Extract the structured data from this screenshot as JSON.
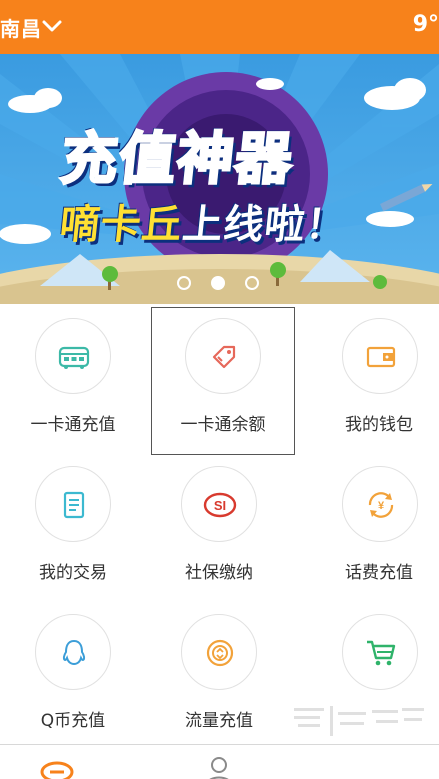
{
  "header": {
    "city": "南昌",
    "weather": "9°",
    "chevron_icon": "chevron-down-icon",
    "bg_color": "#f7821b"
  },
  "banner": {
    "title_line1": "充值神器",
    "title_line2_yellow": "嘀卡丘",
    "title_line2_white": "上线啦！",
    "pagination": {
      "total": 3,
      "active": 2
    }
  },
  "grid": {
    "items": [
      {
        "label": "一卡通充值",
        "icon": "bus-icon",
        "selected": false
      },
      {
        "label": "一卡通余额",
        "icon": "tag-icon",
        "selected": true
      },
      {
        "label": "我的钱包",
        "icon": "wallet-icon",
        "selected": false
      },
      {
        "label": "我的交易",
        "icon": "document-icon",
        "selected": false
      },
      {
        "label": "社保缴纳",
        "icon": "social-security-icon",
        "selected": false
      },
      {
        "label": "话费充值",
        "icon": "phone-recharge-icon",
        "selected": false
      },
      {
        "label": "Q币充值",
        "icon": "qq-icon",
        "selected": false
      },
      {
        "label": "流量充值",
        "icon": "data-traffic-icon",
        "selected": false
      },
      {
        "label": "",
        "icon": "cart-icon",
        "selected": false
      }
    ]
  },
  "tabbar": {
    "tabs": [
      {
        "icon": "home-logo-icon"
      },
      {
        "icon": "user-icon"
      }
    ]
  }
}
